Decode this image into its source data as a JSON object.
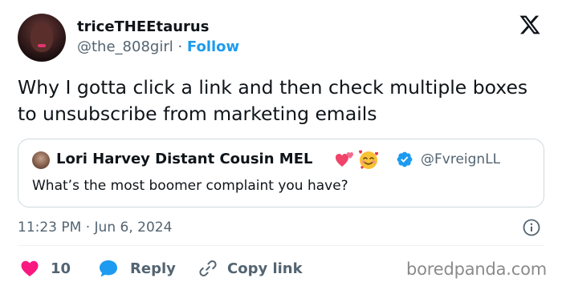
{
  "author": {
    "display_name": "triceTHEEtaurus",
    "handle": "@the_808girl",
    "separator": " · ",
    "follow_label": "Follow"
  },
  "tweet": {
    "text": "Why I gotta click a link and then check multiple boxes to unsubscribe from marketing emails"
  },
  "quoted_tweet": {
    "display_name": "Lori Harvey Distant Cousin MEL",
    "handle": "@FvreignLL",
    "text": "What’s the most boomer complaint you have?",
    "emojis": [
      "two-hearts-emoji",
      "smiling-face-with-hearts-emoji"
    ]
  },
  "meta": {
    "time": "11:23 PM",
    "separator": " · ",
    "date": "Jun 6, 2024"
  },
  "actions": {
    "like_count": "10",
    "reply_label": "Reply",
    "copy_link_label": "Copy link"
  },
  "watermark": "boredpanda.com",
  "colors": {
    "accent": "#1d9bf0",
    "like": "#f91880",
    "secondary_text": "#536471"
  }
}
